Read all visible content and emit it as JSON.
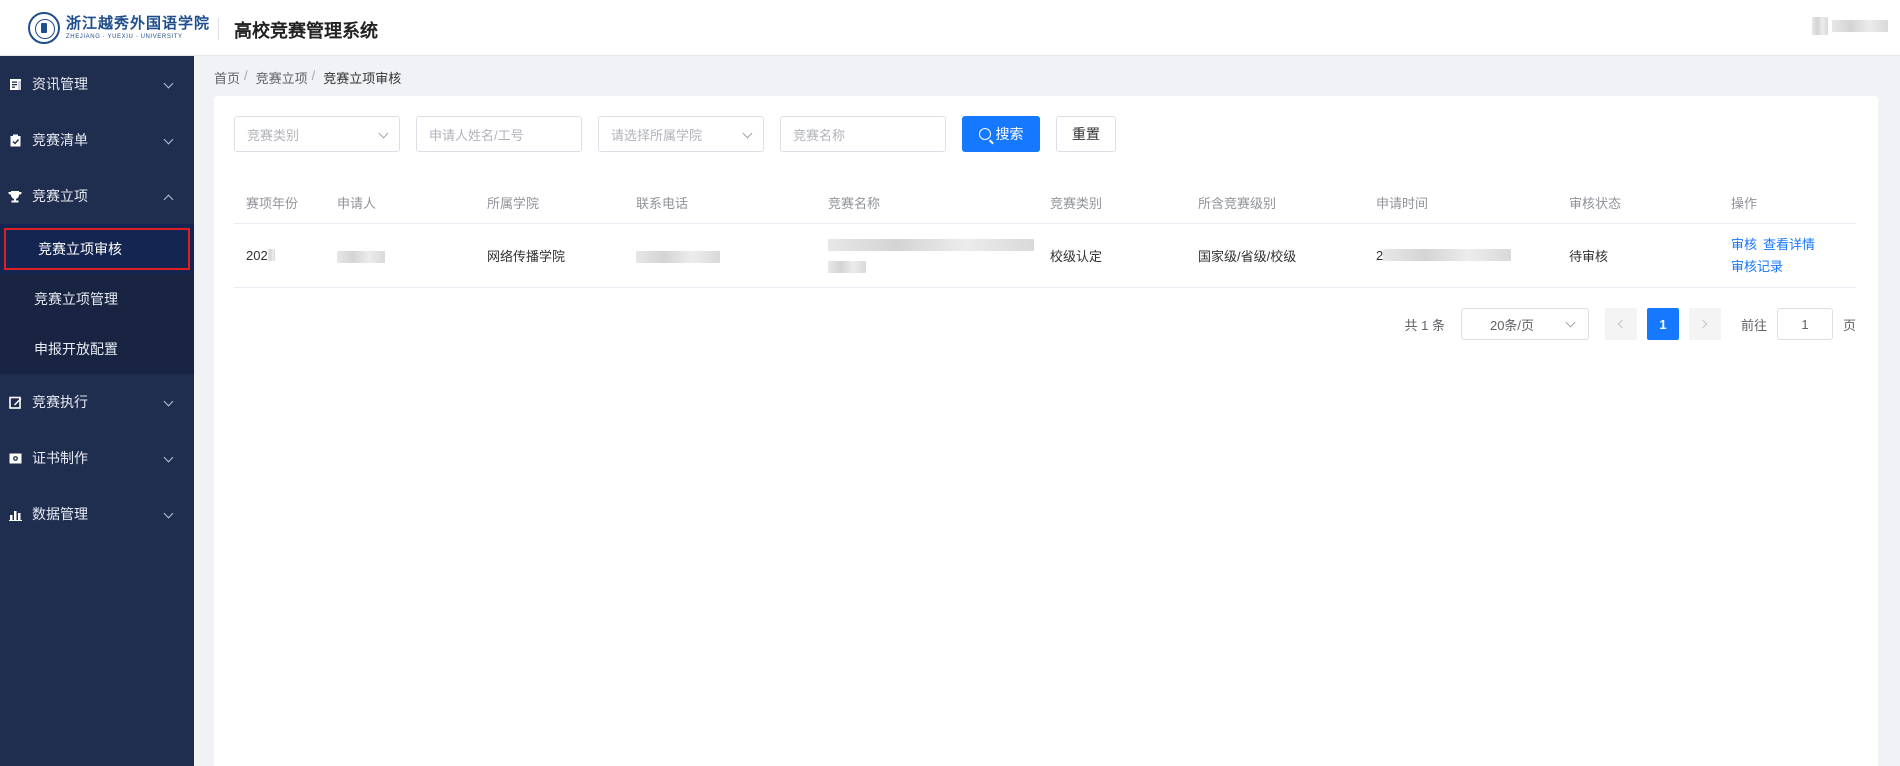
{
  "header": {
    "school_name_cn": "浙江越秀外国语学院",
    "school_name_en": "ZHEJIANG · YUEXIU · UNIVERSITY",
    "app_title": "高校竞赛管理系统"
  },
  "sidebar": {
    "menus": [
      {
        "label": "资讯管理",
        "icon": "document-icon",
        "expanded": false
      },
      {
        "label": "竞赛清单",
        "icon": "clipboard-icon",
        "expanded": false
      },
      {
        "label": "竞赛立项",
        "icon": "trophy-icon",
        "expanded": true,
        "children": [
          "竞赛立项审核",
          "竞赛立项管理",
          "申报开放配置"
        ]
      },
      {
        "label": "竞赛执行",
        "icon": "edit-icon",
        "expanded": false
      },
      {
        "label": "证书制作",
        "icon": "certificate-icon",
        "expanded": false
      },
      {
        "label": "数据管理",
        "icon": "bar-chart-icon",
        "expanded": false
      }
    ],
    "active_child": "竞赛立项审核"
  },
  "breadcrumb": [
    "首页",
    "竞赛立项",
    "竞赛立项审核"
  ],
  "filters": {
    "category_placeholder": "竞赛类别",
    "applicant_placeholder": "申请人姓名/工号",
    "college_placeholder": "请选择所属学院",
    "name_placeholder": "竞赛名称",
    "search_label": "搜索",
    "reset_label": "重置"
  },
  "table": {
    "columns": [
      "赛项年份",
      "申请人",
      "所属学院",
      "联系电话",
      "竞赛名称",
      "竞赛类别",
      "所含竞赛级别",
      "申请时间",
      "审核状态",
      "操作"
    ],
    "rows": [
      {
        "year": "202",
        "college": "网络传播学院",
        "category": "校级认定",
        "levels": "国家级/省级/校级",
        "apply_time_prefix": "2",
        "status": "待审核",
        "actions": [
          "审核",
          "查看详情",
          "审核记录"
        ]
      }
    ]
  },
  "pagination": {
    "total_text": "共 1 条",
    "page_size": "20条/页",
    "current_page": "1",
    "goto_label": "前往",
    "goto_value": "1",
    "page_unit": "页"
  },
  "colors": {
    "sidebar_bg": "#1f2d4f",
    "primary": "#1677ff",
    "highlight_border": "#e02020"
  }
}
